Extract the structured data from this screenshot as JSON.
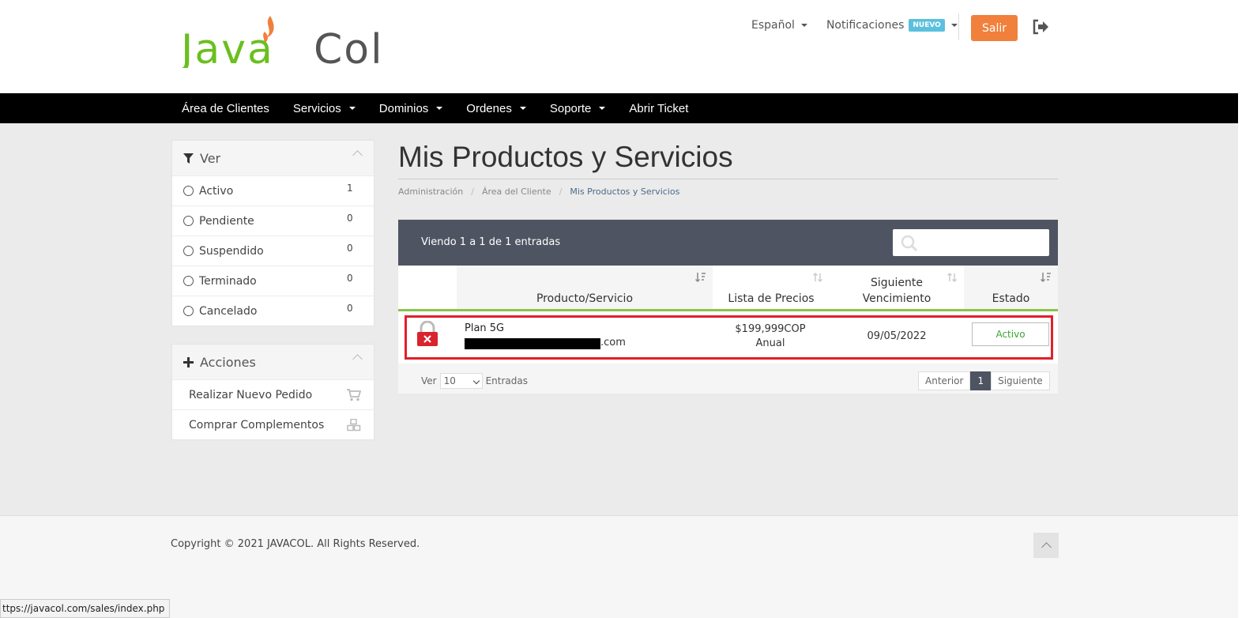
{
  "logo": {
    "text_left": "Java",
    "text_right": "Col",
    "green": "#6bbf1e",
    "gray": "#555555",
    "flame": "#f0803c"
  },
  "top_links": {
    "language": "Español",
    "notifications": "Notificaciones",
    "new_badge": "NUEVO",
    "logout_button": "Salir"
  },
  "nav": [
    "Área de Clientes",
    "Servicios",
    "Dominios",
    "Ordenes",
    "Soporte",
    "Abrir Ticket"
  ],
  "sidebar": {
    "filter": {
      "title": "Ver",
      "items": [
        {
          "label": "Activo",
          "count": "1"
        },
        {
          "label": "Pendiente",
          "count": "0"
        },
        {
          "label": "Suspendido",
          "count": "0"
        },
        {
          "label": "Terminado",
          "count": "0"
        },
        {
          "label": "Cancelado",
          "count": "0"
        }
      ]
    },
    "actions": {
      "title": "Acciones",
      "items": [
        {
          "label": "Realizar Nuevo Pedido",
          "icon": "cart-icon"
        },
        {
          "label": "Comprar Complementos",
          "icon": "cubes-icon"
        }
      ]
    }
  },
  "main": {
    "title": "Mis Productos y Servicios",
    "breadcrumb": [
      "Administración",
      "Área del Cliente",
      "Mis Productos y Servicios"
    ],
    "table": {
      "info": "Viendo 1 a 1 de 1 entradas",
      "columns": [
        "Producto/Servicio",
        "Lista de Precios",
        "Siguiente",
        "Vencimiento",
        "Estado"
      ],
      "rows": [
        {
          "product": "Plan 5G",
          "domain_suffix": ".com",
          "price": "$199,999COP",
          "cycle": "Anual",
          "due": "09/05/2022",
          "status": "Activo"
        }
      ],
      "length_prefix": "Ver",
      "length_value": "10",
      "length_suffix": "Entradas",
      "pager": {
        "prev": "Anterior",
        "current": "1",
        "next": "Siguiente"
      }
    }
  },
  "footer": {
    "copyright": "Copyright © 2021 JAVACOL. All Rights Reserved."
  },
  "status_url": "ttps://javacol.com/sales/index.php",
  "colors": {
    "navbar": "#000000",
    "accent_orange": "#f0803c",
    "table_header": "#4f5462",
    "status_green": "#3ea338",
    "highlight_red": "#e0202a"
  }
}
